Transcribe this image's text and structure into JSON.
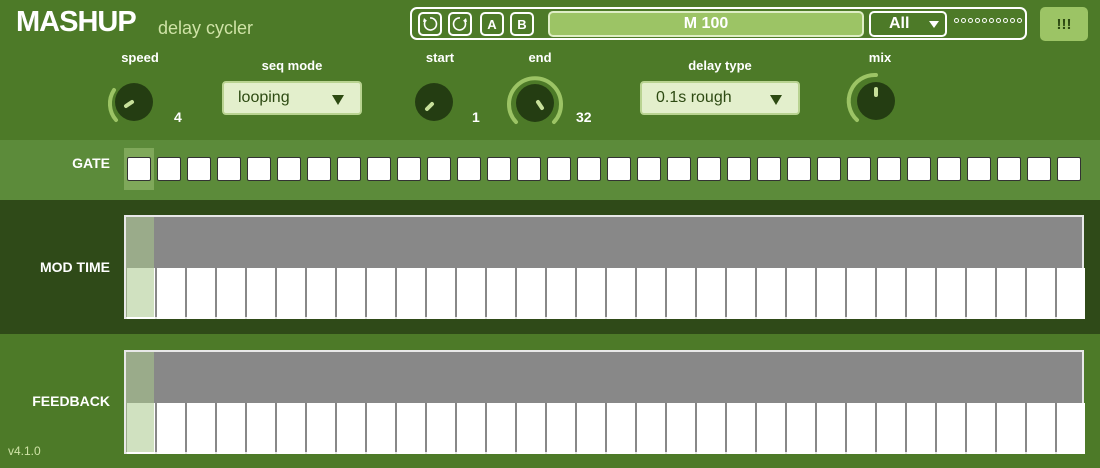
{
  "header": {
    "brand": "MASHUP",
    "subtitle": "delay cycler",
    "version": "v4.1.0"
  },
  "toolbar": {
    "undo_icon": "undo-icon",
    "redo_icon": "redo-icon",
    "a_label": "A",
    "b_label": "B",
    "preset_name": "M 100",
    "scope_value": "All",
    "alert_label": "!!!"
  },
  "controls": {
    "speed": {
      "label": "speed",
      "value": "4"
    },
    "seq_mode": {
      "label": "seq mode",
      "value": "looping"
    },
    "start": {
      "label": "start",
      "value": "1"
    },
    "end": {
      "label": "end",
      "value": "32"
    },
    "delay_type": {
      "label": "delay type",
      "value": "0.1s rough"
    },
    "mix": {
      "label": "mix"
    }
  },
  "sections": {
    "gate": "GATE",
    "mod_time": "MOD TIME",
    "feedback": "FEEDBACK"
  },
  "colors": {
    "background": "#4d7a28",
    "accent": "#9cc465",
    "dark_band": "#2f4a18",
    "knob": "#243d12"
  }
}
